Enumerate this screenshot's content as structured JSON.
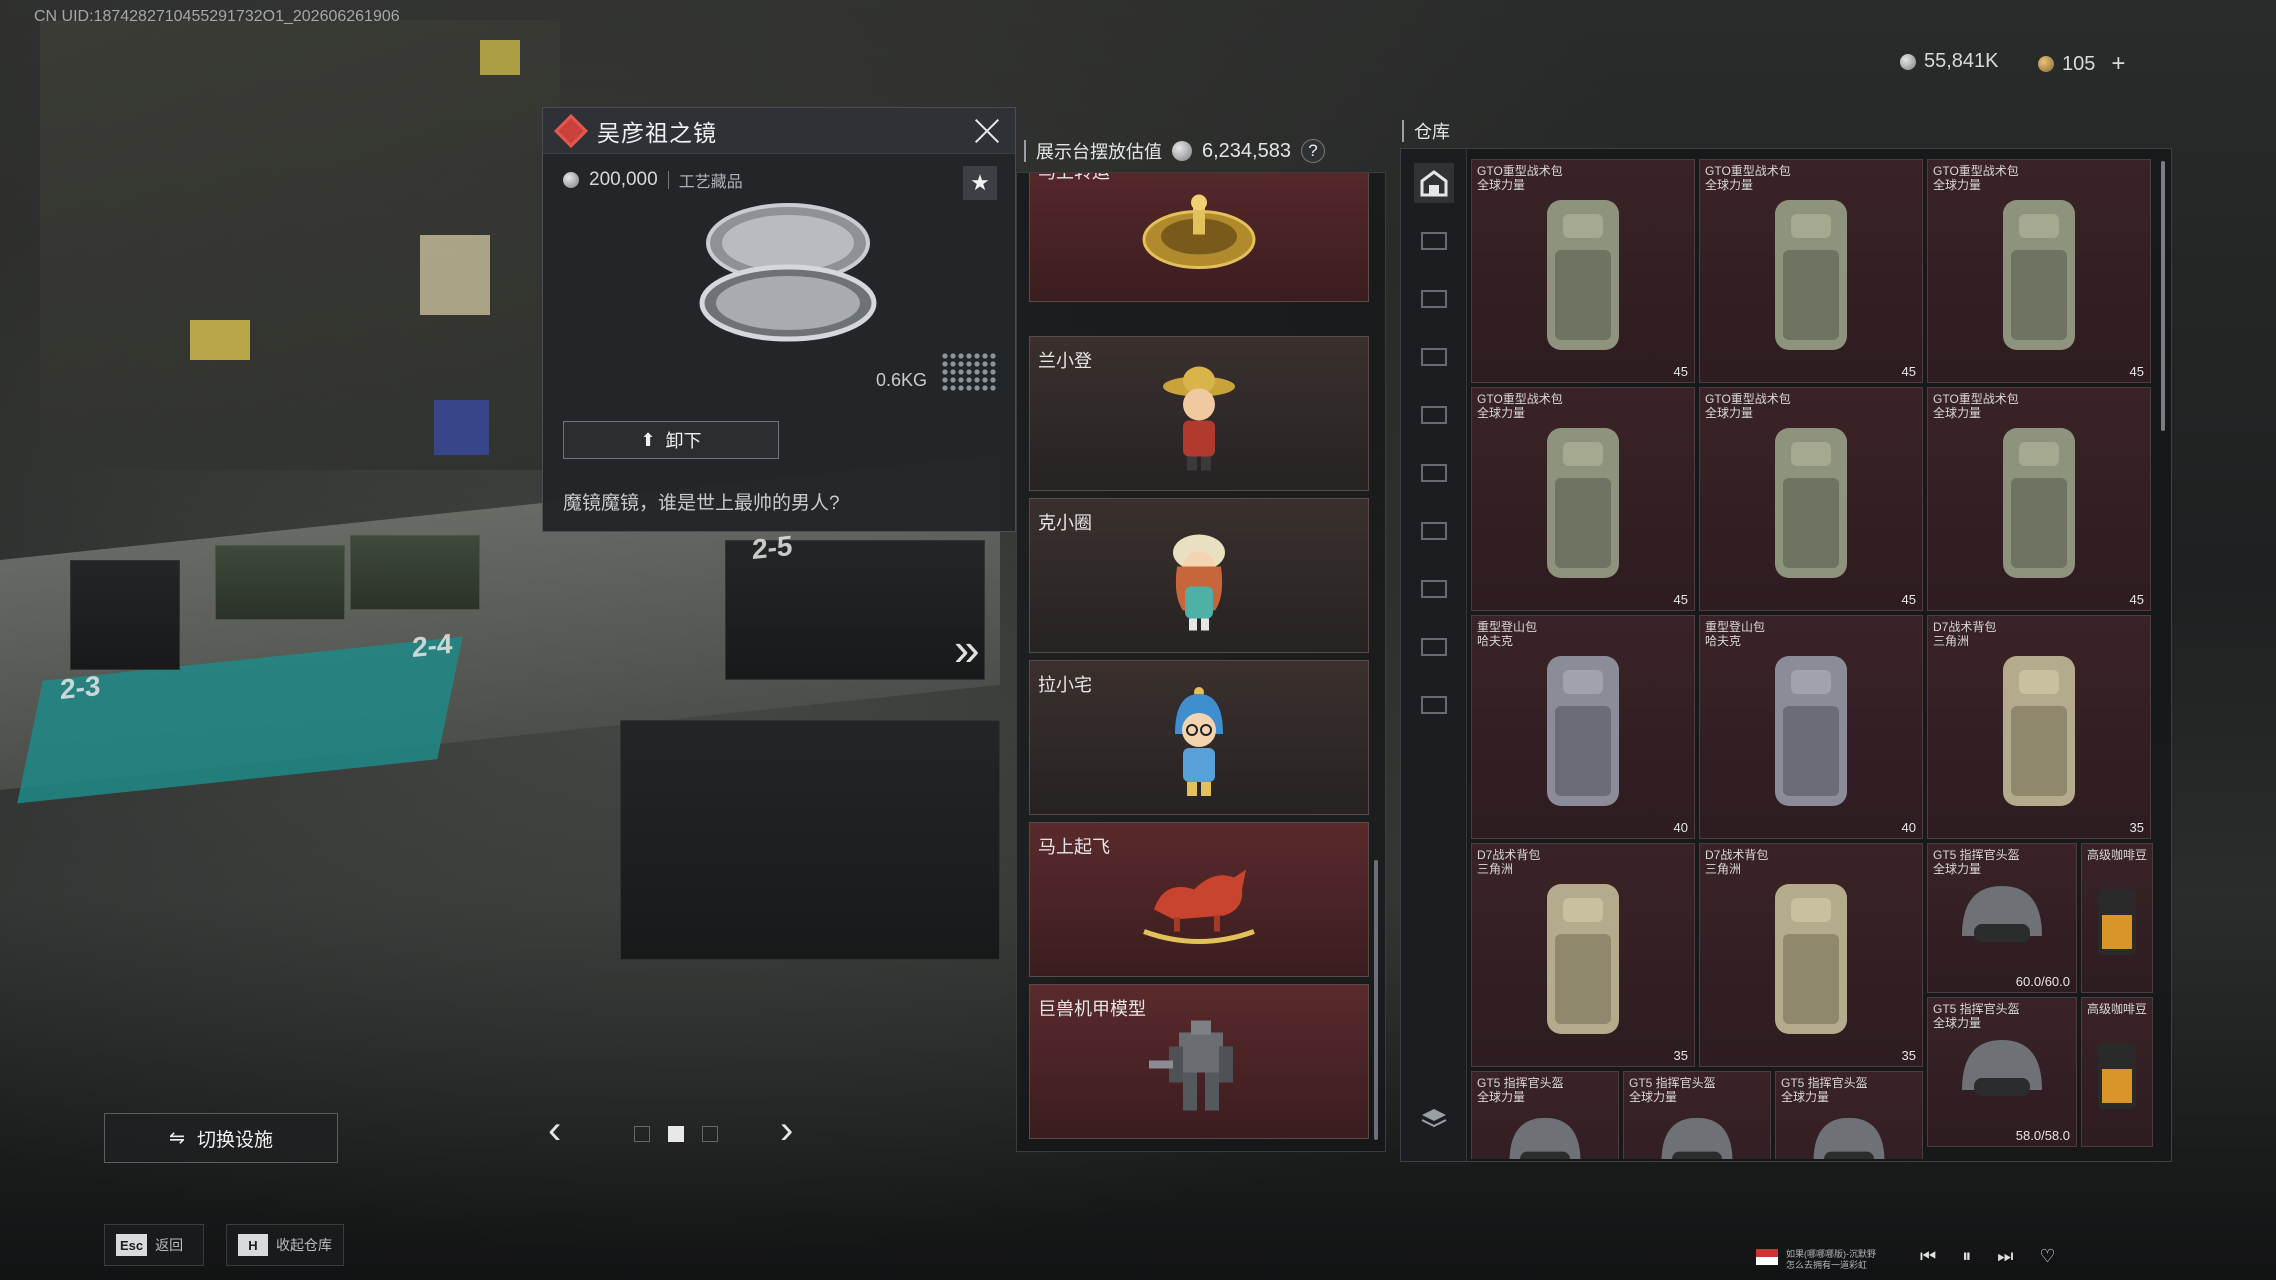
{
  "uid": "CN UID:1874282710455291732O1_202606261906",
  "currency": {
    "silver": "55,841K",
    "gold": "105",
    "add": "+"
  },
  "scene_labels": [
    "2-5",
    "2-4",
    "2-3"
  ],
  "detail": {
    "title": "吴彦祖之镜",
    "price": "200,000",
    "category": "工艺藏品",
    "weight": "0.6KG",
    "unload_label": "卸下",
    "description": "魔镜魔镜，谁是世上最帅的男人?"
  },
  "stand": {
    "title": "展示台摆放估值",
    "value": "6,234,583",
    "help": "?",
    "slots": [
      {
        "label": "马上转运"
      },
      {
        "label": "兰小登"
      },
      {
        "label": "克小圈"
      },
      {
        "label": "拉小宅"
      },
      {
        "label": "马上起飞"
      },
      {
        "label": "巨兽机甲模型"
      }
    ]
  },
  "warehouse": {
    "title": "仓库",
    "items": [
      {
        "name": "GTO重型战术包\n全球力量",
        "count": "45"
      },
      {
        "name": "GTO重型战术包\n全球力量",
        "count": "45"
      },
      {
        "name": "GTO重型战术包\n全球力量",
        "count": "45"
      },
      {
        "name": "GTO重型战术包\n全球力量",
        "count": "45"
      },
      {
        "name": "GTO重型战术包\n全球力量",
        "count": "45"
      },
      {
        "name": "GTO重型战术包\n全球力量",
        "count": "45"
      },
      {
        "name": "重型登山包\n哈夫克",
        "count": "40"
      },
      {
        "name": "重型登山包\n哈夫克",
        "count": "40"
      },
      {
        "name": "D7战术背包\n三角洲",
        "count": "35"
      },
      {
        "name": "D7战术背包\n三角洲",
        "count": "35"
      },
      {
        "name": "D7战术背包\n三角洲",
        "count": "35"
      },
      {
        "name": "GT5 指挥官头盔\n全球力量",
        "count": "60.0/60.0"
      },
      {
        "name": "高级咖啡豆",
        "count": ""
      },
      {
        "name": "GT5 指挥官头盔\n全球力量",
        "count": "58.0/58.0"
      },
      {
        "name": "高级咖啡豆",
        "count": ""
      },
      {
        "name": "GT5 指挥官头盔\n全球力量",
        "count": ""
      },
      {
        "name": "GT5 指挥官头盔\n全球力量",
        "count": ""
      },
      {
        "name": "GT5 指挥官头盔\n全球力量",
        "count": ""
      }
    ]
  },
  "bottom": {
    "switch_label": "切换设施",
    "esc_key": "Esc",
    "esc_label": "返回",
    "h_key": "H",
    "h_label": "收起仓库",
    "music_line1": "如果(哪哪哪版)-沉默野",
    "music_line2": "怎么去拥有一道彩虹"
  },
  "colors": {
    "accent_red": "#c9413a",
    "slot_red": "#5a2a2c",
    "cell_bg": "#3a2327"
  }
}
